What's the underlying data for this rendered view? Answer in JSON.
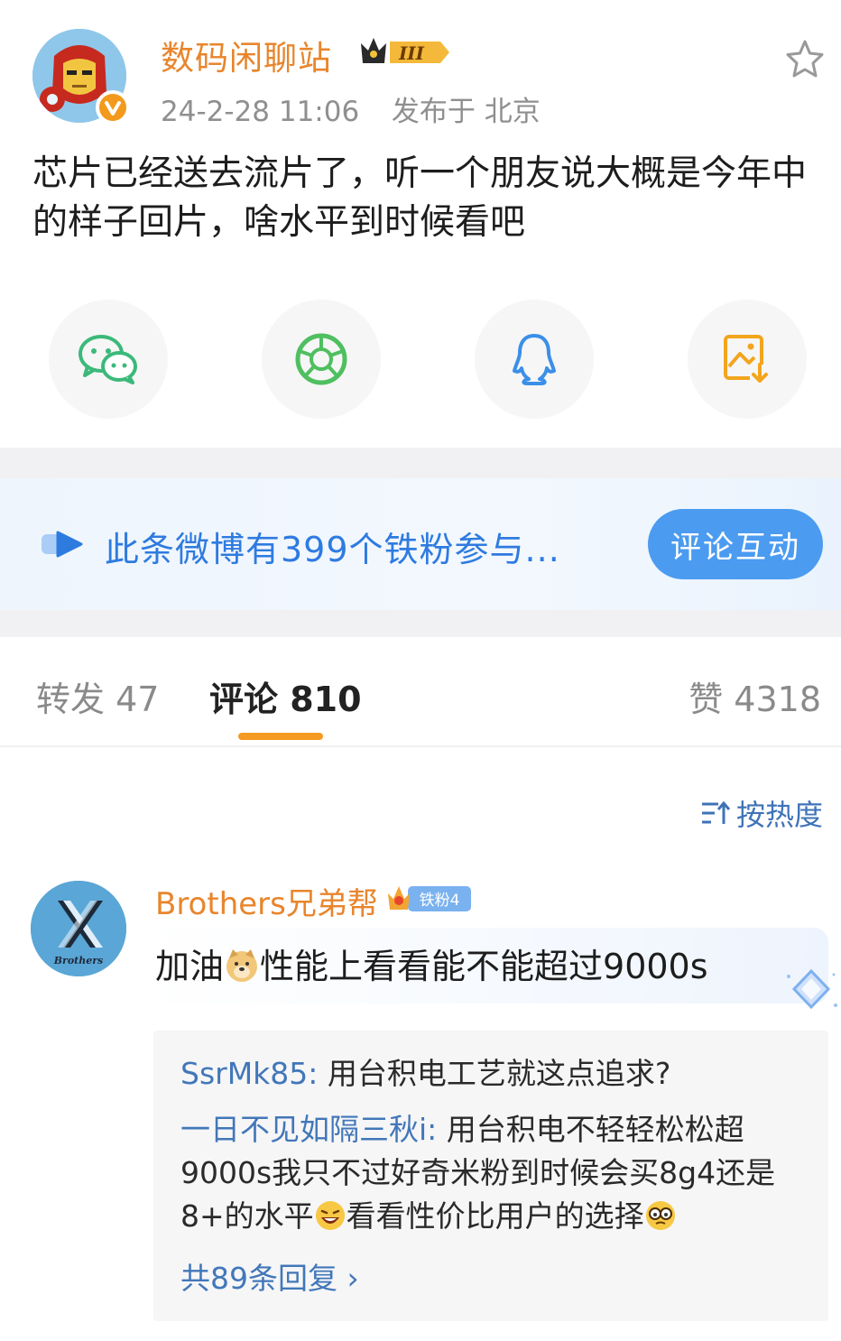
{
  "post": {
    "author": "数码闲聊站",
    "level_badge": "III",
    "timestamp": "24-2-28 11:06",
    "location": "发布于 北京",
    "text": "芯片已经送去流片了，听一个朋友说大概是今年中的样子回片，啥水平到时候看吧"
  },
  "share": {
    "items": [
      {
        "icon": "wechat-icon",
        "color": "#3cb97a"
      },
      {
        "icon": "moments-icon",
        "color": "#4fbf60"
      },
      {
        "icon": "qq-icon",
        "color": "#3b8fe8"
      },
      {
        "icon": "save-image-icon",
        "color": "#f2a51d"
      }
    ]
  },
  "fan_banner": {
    "text": "此条微博有399个铁粉参与...",
    "button": "评论互动"
  },
  "tabs": {
    "repost": "转发 47",
    "comment": "评论 810",
    "like": "赞 4318"
  },
  "sort": {
    "label": "按热度"
  },
  "comment": {
    "author": "Brothers兄弟帮",
    "avatar_text": "Brothers",
    "fan_badge": "铁粉4",
    "text_before": "加油",
    "text_after": "性能上看看能不能超过9000s"
  },
  "replies": [
    {
      "author": "SsrMk85:",
      "text": " 用台积电工艺就这点追求?"
    },
    {
      "author": "一日不见如隔三秋i:",
      "text": " 用台积电不轻轻松松超9000s我只不过好奇米粉到时候会买8g4还是8+的水平",
      "text_mid": "看看性价比用户的选择"
    }
  ],
  "more_replies": "共89条回复 ›",
  "colors": {
    "accent_orange": "#f59a23",
    "author_orange": "#e8852c",
    "link_blue": "#4277b9",
    "banner_blue": "#4b9bf1"
  }
}
